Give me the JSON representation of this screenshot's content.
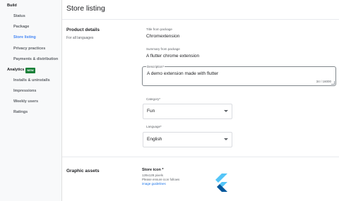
{
  "sidebar": {
    "build_heading": "Build",
    "items_build": [
      {
        "label": "Status"
      },
      {
        "label": "Package"
      },
      {
        "label": "Store listing"
      },
      {
        "label": "Privacy practices"
      },
      {
        "label": "Payments & distribution"
      }
    ],
    "analytics_heading": "Analytics",
    "new_badge": "NEW",
    "items_analytics": [
      {
        "label": "Installs & uninstalls"
      },
      {
        "label": "Impressions"
      },
      {
        "label": "Weekly users"
      },
      {
        "label": "Ratings"
      }
    ],
    "active_item": "Store listing"
  },
  "main": {
    "page_title": "Store listing",
    "product_details": {
      "title": "Product details",
      "subtitle": "For all languages",
      "title_from_package_label": "Title from package",
      "title_from_package_value": "Chromextension",
      "summary_from_package_label": "Summary from package",
      "summary_from_package_value": "A flutter chrome extension",
      "description_label": "Description*",
      "description_value": "A demo extension made with flutter",
      "description_count": "34 / 16000",
      "category_label": "Category*",
      "category_value": "Fun",
      "language_label": "Language*",
      "language_value": "English"
    },
    "graphic_assets": {
      "title": "Graphic assets",
      "store_icon_title": "Store icon *",
      "store_icon_size": "128x128 pixels",
      "store_icon_note": "Please ensure icon follows",
      "image_guidelines_link": "image guidelines"
    }
  },
  "colors": {
    "accent": "#4285f4",
    "badge_green": "#188038",
    "link_blue": "#1a73e8",
    "flutter_light": "#54c5f8",
    "flutter_dark": "#01579b"
  }
}
